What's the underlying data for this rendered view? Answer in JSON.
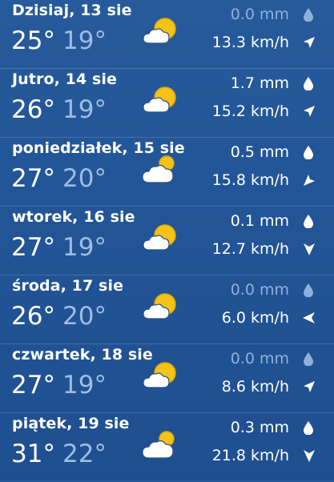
{
  "days": [
    {
      "label": "Dzisiaj, 13 sie",
      "tmax": "25°",
      "tmin": "19°",
      "icon": "sun-cloud-icon",
      "precip": "0.0 mm",
      "wind": "13.3 km/h",
      "wind_dir": "north-east",
      "dry": true
    },
    {
      "label": "Jutro, 14 sie",
      "tmax": "26°",
      "tmin": "19°",
      "icon": "sun-cloud-icon",
      "precip": "1.7 mm",
      "wind": "15.2 km/h",
      "wind_dir": "north-east",
      "dry": false
    },
    {
      "label": "poniedziałek, 15 sie",
      "tmax": "27°",
      "tmin": "20°",
      "icon": "cloud-sun-icon",
      "precip": "0.5 mm",
      "wind": "15.8 km/h",
      "wind_dir": "south-west",
      "dry": false
    },
    {
      "label": "wtorek, 16 sie",
      "tmax": "27°",
      "tmin": "19°",
      "icon": "sun-cloud-icon",
      "precip": "0.1 mm",
      "wind": "12.7 km/h",
      "wind_dir": "south",
      "dry": false
    },
    {
      "label": "środa, 17 sie",
      "tmax": "26°",
      "tmin": "20°",
      "icon": "sun-cloud-icon",
      "precip": "0.0 mm",
      "wind": "6.0 km/h",
      "wind_dir": "west",
      "dry": true
    },
    {
      "label": "czwartek, 18 sie",
      "tmax": "27°",
      "tmin": "19°",
      "icon": "sun-cloud-icon",
      "precip": "0.0 mm",
      "wind": "8.6 km/h",
      "wind_dir": "north-east",
      "dry": true
    },
    {
      "label": "piątek, 19 sie",
      "tmax": "31°",
      "tmin": "22°",
      "icon": "cloud-sun-icon",
      "precip": "0.3 mm",
      "wind": "21.8 km/h",
      "wind_dir": "south",
      "dry": false
    }
  ],
  "colors": {
    "background": "#225597",
    "text": "#ffffff",
    "min_temp": "#9fbde0",
    "dry_precip": "#8fb0d8",
    "sun": "#f5c218",
    "sun_outline": "#e0a800"
  }
}
